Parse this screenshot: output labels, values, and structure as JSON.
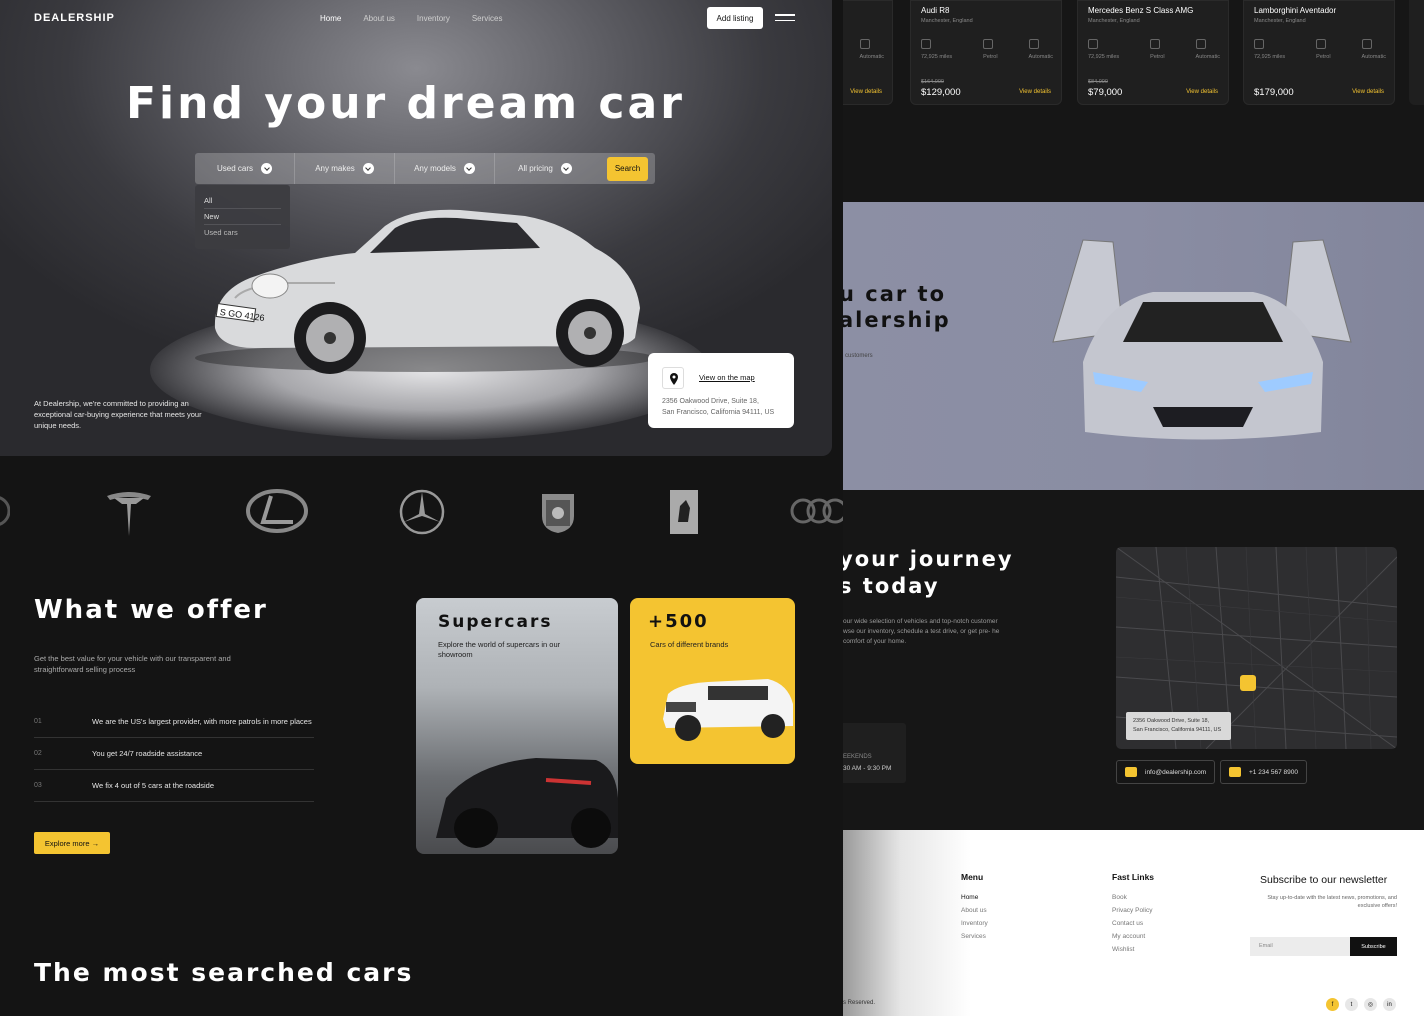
{
  "header": {
    "brand": "DEALERSHIP",
    "nav": [
      "Home",
      "About us",
      "Inventory",
      "Services"
    ],
    "add_listing": "Add listing"
  },
  "hero": {
    "title": "Find your dream car",
    "search": {
      "fields": [
        "Used cars",
        "Any makes",
        "Any models",
        "All pricing"
      ],
      "button": "Search",
      "dropdown_options": [
        "All",
        "New",
        "Used cars"
      ]
    },
    "plate": "S GO 4126",
    "copy": "At Dealership, we're committed to providing an exceptional car-buying experience that meets your unique needs.",
    "map_card": {
      "link": "View on the map",
      "address_line1": "2356 Oakwood Drive, Suite 18,",
      "address_line2": "San Francisco, California 94111, US"
    }
  },
  "brands": [
    "Tesla",
    "Lexus",
    "Mercedes-Benz",
    "Porsche",
    "Ferrari",
    "Audi"
  ],
  "offer": {
    "title": "What we offer",
    "subtitle": "Get the best value for your vehicle with our transparent and straightforward selling process",
    "items": [
      {
        "num": "01",
        "text": "We are the US's largest provider, with more patrols in more places"
      },
      {
        "num": "02",
        "text": "You get 24/7 roadside assistance"
      },
      {
        "num": "03",
        "text": "We fix 4 out of 5 cars at the roadside"
      }
    ],
    "explore": "Explore more",
    "supercars": {
      "title": "Supercars",
      "desc": "Explore the world of supercars in our showroom"
    },
    "brands_card": {
      "title": "+500",
      "desc": "Cars of different brands"
    }
  },
  "most_searched": "The most searched cars",
  "cars": [
    {
      "name": "",
      "location": "",
      "specs": [
        "",
        "",
        "Automatic"
      ],
      "old_price": "",
      "price": "",
      "view": "View details"
    },
    {
      "name": "Audi R8",
      "location": "Manchester, England",
      "specs": [
        "72,925 miles",
        "Petrol",
        "Automatic"
      ],
      "old_price": "$164,000",
      "price": "$129,000",
      "view": "View details"
    },
    {
      "name": "Mercedes Benz S Class AMG",
      "location": "Manchester, England",
      "specs": [
        "72,925 miles",
        "Petrol",
        "Automatic"
      ],
      "old_price": "$84,000",
      "price": "$79,000",
      "view": "View details"
    },
    {
      "name": "Lamborghini Aventador",
      "location": "Manchester, England",
      "specs": [
        "72,925 miles",
        "Petrol",
        "Automatic"
      ],
      "old_price": "",
      "price": "$179,000",
      "view": "View details"
    }
  ],
  "sell": {
    "title_line1": "u car to",
    "title_line2": "alership",
    "sub": "customers"
  },
  "journey": {
    "title_line1": "your journey",
    "title_line2": "s today",
    "text": "our wide selection of vehicles and top-notch customer wse our inventory, schedule a test drive, or get pre- he comfort of your home.",
    "hours_label": "EEKENDS",
    "hours": "30 AM - 9:30 PM",
    "map_address_line1": "2356 Oakwood Drive, Suite 18,",
    "map_address_line2": "San Francisco, California 94111, US",
    "email": "info@dealership.com",
    "phone": "+1 234 567 8900"
  },
  "footer": {
    "menu_title": "Menu",
    "menu": [
      "Home",
      "About us",
      "Inventory",
      "Services"
    ],
    "links_title": "Fast Links",
    "links": [
      "Book",
      "Privacy Policy",
      "Contact us",
      "My account",
      "Wishlist"
    ],
    "newsletter_title": "Subscribe to our newsletter",
    "newsletter_sub": "Stay up-to-date with the latest news, promotions, and exclusive offers!",
    "email_placeholder": "Email",
    "subscribe": "Subscribe",
    "rights": "s Reserved.",
    "socials": [
      "facebook-icon",
      "twitter-icon",
      "instagram-icon",
      "linkedin-icon"
    ]
  },
  "colors": {
    "accent": "#f4c431",
    "bg": "#141414"
  }
}
